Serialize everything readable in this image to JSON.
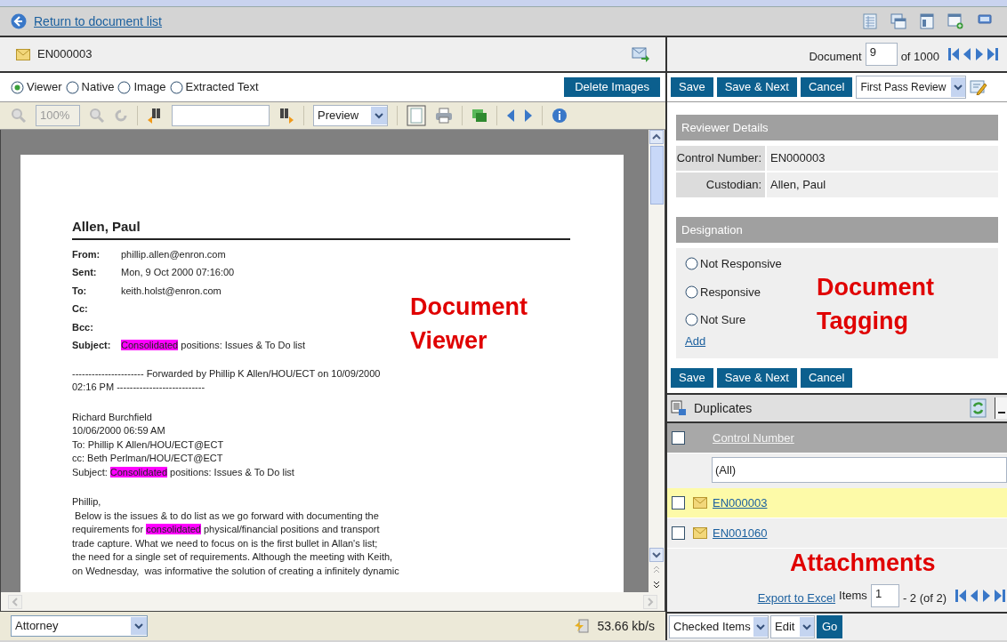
{
  "top_bar": {
    "back_link": "Return to document list"
  },
  "viewer": {
    "doc_id": "EN000003",
    "view_modes": [
      {
        "label": "Viewer",
        "selected": true
      },
      {
        "label": "Native",
        "selected": false
      },
      {
        "label": "Image",
        "selected": false
      },
      {
        "label": "Extracted Text",
        "selected": false
      }
    ],
    "delete_button": "Delete Images",
    "zoom": "100%",
    "page_mode": "Preview",
    "document": {
      "title": "Allen, Paul",
      "fields": [
        {
          "label": "From:",
          "value": [
            {
              "text": "phillip.allen@enron.com",
              "highlighted": false
            }
          ]
        },
        {
          "label": "Sent:",
          "value": [
            {
              "text": "Mon, 9 Oct 2000 07:16:00",
              "highlighted": false
            }
          ]
        },
        {
          "label": "To:",
          "value": [
            {
              "text": "keith.holst@enron.com",
              "highlighted": false
            }
          ]
        },
        {
          "label": "Cc:"
        },
        {
          "label": "Bcc:"
        },
        {
          "label": "Subject:",
          "value": [
            {
              "text": "Consolidated",
              "highlighted": true
            },
            {
              "text": " positions: Issues & To Do list",
              "highlighted": false
            }
          ]
        }
      ],
      "paragraphs": [
        [
          [
            {
              "text": "---------------------- Forwarded by Phillip K Allen/HOU/ECT on 10/09/2000",
              "highlighted": false
            }
          ],
          [
            {
              "text": "02:16 PM ---------------------------",
              "highlighted": false
            }
          ]
        ],
        [
          [
            {
              "text": "Richard Burchfield",
              "highlighted": false
            }
          ],
          [
            {
              "text": "10/06/2000 06:59 AM",
              "highlighted": false
            }
          ],
          [
            {
              "text": "To: Phillip K Allen/HOU/ECT@ECT",
              "highlighted": false
            }
          ],
          [
            {
              "text": "cc: Beth Perlman/HOU/ECT@ECT",
              "highlighted": false
            }
          ],
          [
            {
              "text": "Subject: ",
              "highlighted": false
            },
            {
              "text": "Consolidated",
              "highlighted": true
            },
            {
              "text": " positions: Issues & To Do list",
              "highlighted": false
            }
          ]
        ],
        [
          [
            {
              "text": "Phillip,",
              "highlighted": false
            }
          ],
          [
            {
              "text": " Below is the issues & to do list as we go forward with documenting the",
              "highlighted": false
            }
          ],
          [
            {
              "text": "requirements for ",
              "highlighted": false
            },
            {
              "text": "consolidated",
              "highlighted": true
            },
            {
              "text": " physical/financial positions and transport",
              "highlighted": false
            }
          ],
          [
            {
              "text": "trade capture. What we need to focus on is the first bullet in Allan's list;",
              "highlighted": false
            }
          ],
          [
            {
              "text": "the need for a single set of requirements. Although the meeting with Keith,",
              "highlighted": false
            }
          ],
          [
            {
              "text": "on Wednesday,  was informative the solution of creating a infinitely dynamic",
              "highlighted": false
            }
          ]
        ]
      ]
    },
    "annotation": "Document Viewer",
    "status": {
      "role": "Attorney",
      "speed": "53.66 kb/s"
    }
  },
  "navigator": {
    "label": "Document",
    "current": "9",
    "total": "of 1000"
  },
  "tagging": {
    "buttons": [
      "Save",
      "Save & Next",
      "Cancel"
    ],
    "layout": "First Pass Review",
    "reviewer_details": {
      "title": "Reviewer Details",
      "rows": [
        {
          "label": "Control Number:",
          "value": "EN000003"
        },
        {
          "label": "Custodian:",
          "value": "Allen, Paul"
        }
      ]
    },
    "designation": {
      "title": "Designation",
      "options": [
        {
          "label": "Not Responsive",
          "selected": false
        },
        {
          "label": "Responsive",
          "selected": false
        },
        {
          "label": "Not Sure",
          "selected": false
        }
      ],
      "add_link": "Add"
    },
    "annotation": "Document Tagging",
    "bottom_buttons": [
      "Save",
      "Save & Next",
      "Cancel"
    ]
  },
  "duplicates": {
    "title": "Duplicates",
    "select_all_checked": false,
    "column": "Control Number",
    "filter": "(All)",
    "rows": [
      {
        "control_number": "EN000003",
        "checked": false,
        "selected": true
      },
      {
        "control_number": "EN001060",
        "checked": false,
        "selected": false
      }
    ],
    "annotation": "Attachments",
    "export_link": "Export to Excel",
    "items_label": "Items",
    "page": "1",
    "range": "- 2 (of 2)",
    "mass_action": "Checked Items",
    "action": "Edit",
    "go": "Go"
  }
}
